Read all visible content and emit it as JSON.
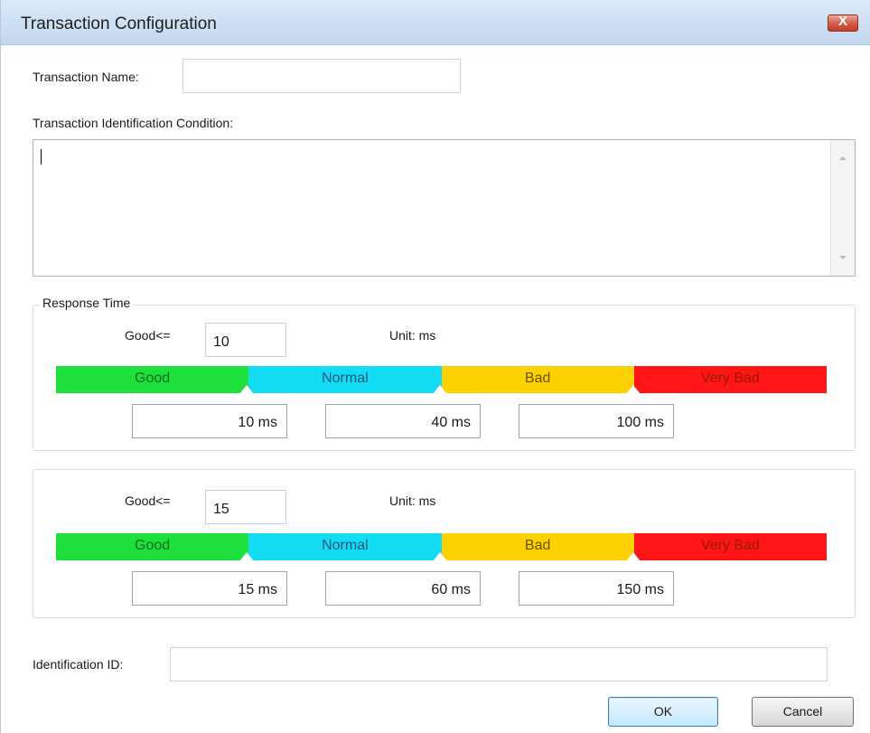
{
  "window": {
    "title": "Transaction Configuration",
    "close_glyph": "X"
  },
  "form": {
    "transaction_name_label": "Transaction Name:",
    "transaction_name_value": "",
    "condition_label": "Transaction Identification Condition:",
    "condition_value": "",
    "identification_id_label": "Identification ID:",
    "identification_id_value": ""
  },
  "response_time": {
    "caption": "Response Time",
    "panels": [
      {
        "good_label": "Good<=",
        "good_value": "10",
        "unit_label": "Unit: ms",
        "segments": [
          "Good",
          "Normal",
          "Bad",
          "Very Bad"
        ],
        "thresholds": [
          "10 ms",
          "40 ms",
          "100 ms"
        ]
      },
      {
        "good_label": "Good<=",
        "good_value": "15",
        "unit_label": "Unit: ms",
        "segments": [
          "Good",
          "Normal",
          "Bad",
          "Very Bad"
        ],
        "thresholds": [
          "15 ms",
          "60 ms",
          "150 ms"
        ]
      }
    ]
  },
  "buttons": {
    "ok": "OK",
    "cancel": "Cancel"
  },
  "colors": {
    "good": "#1ee03c",
    "normal": "#13dcf5",
    "bad": "#fed100",
    "very_bad": "#ff1515",
    "title_bar": "#cddff3",
    "close_button": "#d4604c"
  },
  "icons": {
    "close": "close-icon",
    "scroll_up": "chevron-up-icon",
    "scroll_down": "chevron-down-icon",
    "slider_thumb": "caret-up-icon"
  }
}
